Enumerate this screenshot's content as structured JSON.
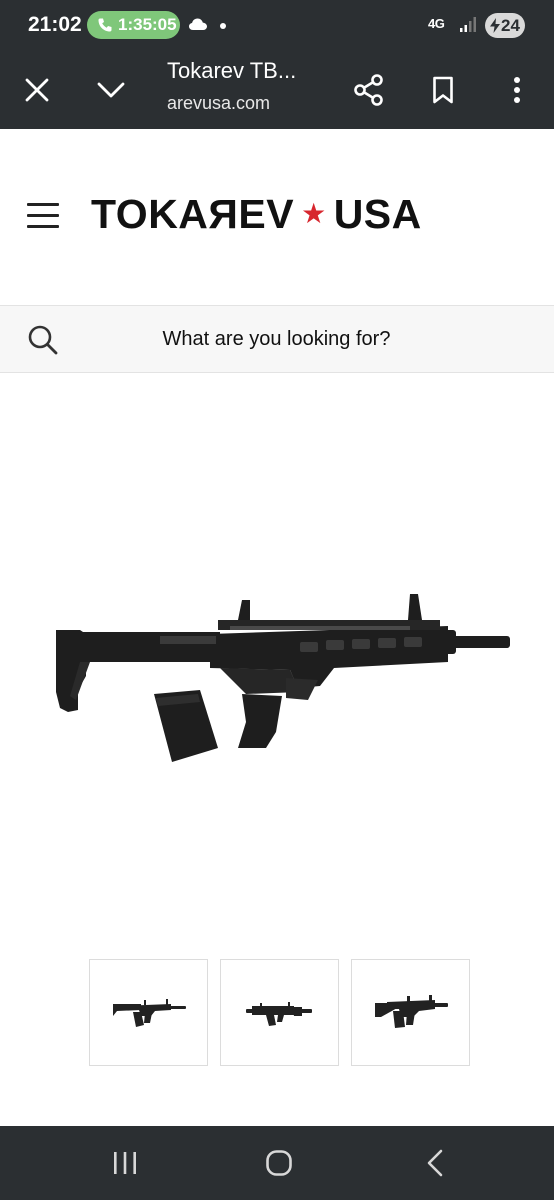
{
  "status_bar": {
    "time": "21:02",
    "call_timer": "1:35:05",
    "network": "4G",
    "battery": "24",
    "icons": [
      "phone-icon",
      "cloud-icon",
      "dot-icon",
      "signal-icon",
      "battery-icon"
    ]
  },
  "browser": {
    "page_title": "Tokarev TB...",
    "url": "arevusa.com",
    "icons": [
      "close-icon",
      "chevron-down-icon",
      "share-icon",
      "bookmark-icon",
      "more-vert-icon"
    ]
  },
  "site": {
    "logo_left": "TOKAЯEV",
    "logo_star": "★",
    "logo_right": "USA",
    "menu_icon": "hamburger-icon",
    "search": {
      "placeholder": "What are you looking for?",
      "icon": "search-icon"
    }
  },
  "product": {
    "main_image": "shotgun-image",
    "thumbnails": [
      "thumbnail-1",
      "thumbnail-2",
      "thumbnail-3"
    ]
  },
  "system_nav": {
    "icons": [
      "recents-icon",
      "home-icon",
      "back-icon"
    ]
  },
  "colors": {
    "chrome": "#2b2f32",
    "call_green": "#7fc77a",
    "logo_red": "#d7262e",
    "search_bg": "#f7f7f7"
  }
}
